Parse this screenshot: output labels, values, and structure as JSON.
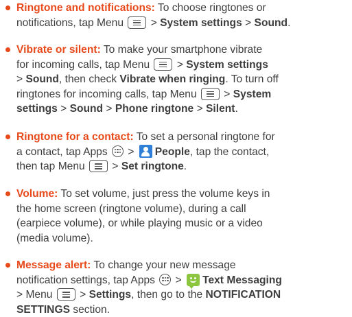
{
  "colors": {
    "accent": "#e84a1c",
    "text": "#3d3d3d",
    "people_icon": "#2f7ed8",
    "msg_icon": "#8cc63f"
  },
  "icons": {
    "menu": "menu-key-icon",
    "apps": "apps-key-icon",
    "people": "people-app-icon",
    "messaging": "text-messaging-app-icon"
  },
  "ringtone": {
    "heading": "Ringtone and notifications:",
    "t1": " To choose ringtones or",
    "t2": "notifications, tap Menu ",
    "t3": " > ",
    "b_system": "System settings",
    "t4": " > ",
    "b_sound": "Sound",
    "t5": "."
  },
  "vibrate": {
    "heading": "Vibrate or silent:",
    "t1": " To make your smartphone vibrate",
    "t2": "for incoming calls, tap Menu ",
    "t3": " > ",
    "b_system": "System settings",
    "t4": "> ",
    "b_sound": "Sound",
    "t5": ", then check ",
    "b_vibrate": "Vibrate when ringing",
    "t6": ". To turn off",
    "t7": "ringtones for incoming calls, tap Menu ",
    "t8": " > ",
    "b_system2": "System",
    "b_settings2": "settings",
    "t9": " > ",
    "b_sound2": "Sound",
    "t10": " > ",
    "b_phone": "Phone ringtone",
    "t11": " > ",
    "b_silent": "Silent",
    "t12": "."
  },
  "contact": {
    "heading": "Ringtone for a contact:",
    "t1": " To set a personal ringtone for",
    "t2": "a contact, tap Apps ",
    "t3": " > ",
    "b_people": "People",
    "t4": ", tap the contact,",
    "t5": "then tap Menu ",
    "t6": " > ",
    "b_set": "Set ringtone",
    "t7": "."
  },
  "volume": {
    "heading": "Volume:",
    "t1": " To set volume, just press the volume keys in",
    "line2": "the home screen (ringtone volume), during a call",
    "line3": "(earpiece volume), or while playing music or a video",
    "line4": "(media volume)."
  },
  "message": {
    "heading": "Message alert:",
    "t1": " To change your new message",
    "t2": "notification settings, tap Apps ",
    "t3": " > ",
    "b_text": "Text Messaging",
    "t4": "> Menu ",
    "t5": " > ",
    "b_settings": "Settings",
    "t6": ", then go to the ",
    "b_notif": "NOTIFICATION",
    "b_section_settings": "SETTINGS",
    "t7": " section."
  }
}
